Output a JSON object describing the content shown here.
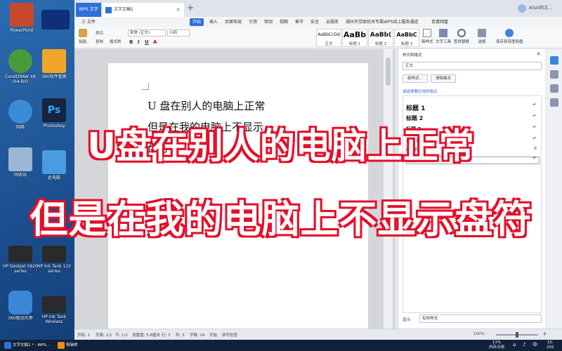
{
  "desktop": {
    "icons": [
      {
        "label": "PowerPoint",
        "color": "#c7482d"
      },
      {
        "label": "",
        "color": "#0e2f7a"
      },
      {
        "label": "CorelDRAW X8 (64-Bit)",
        "color": "#4a9a3a"
      },
      {
        "label": "360软件管家",
        "color": "#f3a52a"
      },
      {
        "label": "网络",
        "color": "#3b8bd6"
      },
      {
        "label": "Photoshop",
        "color": "#16243f"
      },
      {
        "label": "回收站",
        "color": "#9bb7d4"
      },
      {
        "label": "此电脑",
        "color": "#4b9be0"
      },
      {
        "label": "HP DeskJet 5820 series",
        "color": "#2a2a2a"
      },
      {
        "label": "HP Ink Tank 110 series",
        "color": "#2a2a2a"
      },
      {
        "label": "360驱动大师",
        "color": "#3c86d8"
      },
      {
        "label": "HP Ink Tank Wireless",
        "color": "#2a2a2a"
      }
    ]
  },
  "window": {
    "app_tab": "WPS 文字",
    "doc_tab": "文字文稿1",
    "user": "A0a0的文..."
  },
  "menu": {
    "file": "三 文件",
    "items": [
      "开始",
      "插入",
      "页面布局",
      "引用",
      "审阅",
      "视图",
      "章节",
      "安全",
      "云服务",
      "湖州市党政机关专属WPS线上服务通道",
      "百度网盘"
    ]
  },
  "ribbon": {
    "paste": "粘贴",
    "cut": "剪切",
    "copy": "复制",
    "format_painter": "格式刷",
    "font_name": "宋体 (正文)",
    "font_size": "小四",
    "styles": [
      {
        "sample": "AaBbCcDd",
        "name": "正文"
      },
      {
        "sample": "AaBb",
        "name": "标题 1"
      },
      {
        "sample": "AaBb(",
        "name": "标题 2"
      },
      {
        "sample": "AaBbC",
        "name": "标题 3"
      }
    ],
    "new_style": "新样式",
    "text_tools": "文字工具",
    "find_replace": "查找替换",
    "select": "选择",
    "save_cloud": "保存到百度网盘"
  },
  "document": {
    "line1": "U 盘在别人的电脑上正常",
    "line2": "但是在我的电脑上不显示",
    "line3": "盘符"
  },
  "panel": {
    "title": "样式和格式",
    "current": "正文",
    "new_style": "新样式...",
    "clear_format": "清除格式",
    "tip": "请选择要应用的格式",
    "styles": [
      "标题 1",
      "标题 2",
      "标题 3",
      "目录 1",
      "段落字体",
      "正文"
    ],
    "show_label": "显示:",
    "show_value": "有效样式"
  },
  "statusbar": {
    "page_no": "页码: 1",
    "page": "页面: 1/1",
    "section": "节: 1/1",
    "setting": "设置值: 5.8厘米",
    "row": "行: 3",
    "col": "列: 3",
    "words": "字数: 24",
    "mode": "开始",
    "spellcheck": "拼写检查",
    "zoom": "100%",
    "zoom_level": 0.5
  },
  "taskbar": {
    "items": [
      {
        "label": "文字文稿1 * - WPS...",
        "color": "#2f6fd8"
      },
      {
        "label": "剪辑师",
        "color": "#f08c1c"
      }
    ],
    "cpu": "11%",
    "cpu_label": "内存占用",
    "time": "15:",
    "date": "202"
  },
  "caption": {
    "line1": "U盘在别人的电脑上正常",
    "line2": "但是在我的电脑上不显示盘符"
  }
}
